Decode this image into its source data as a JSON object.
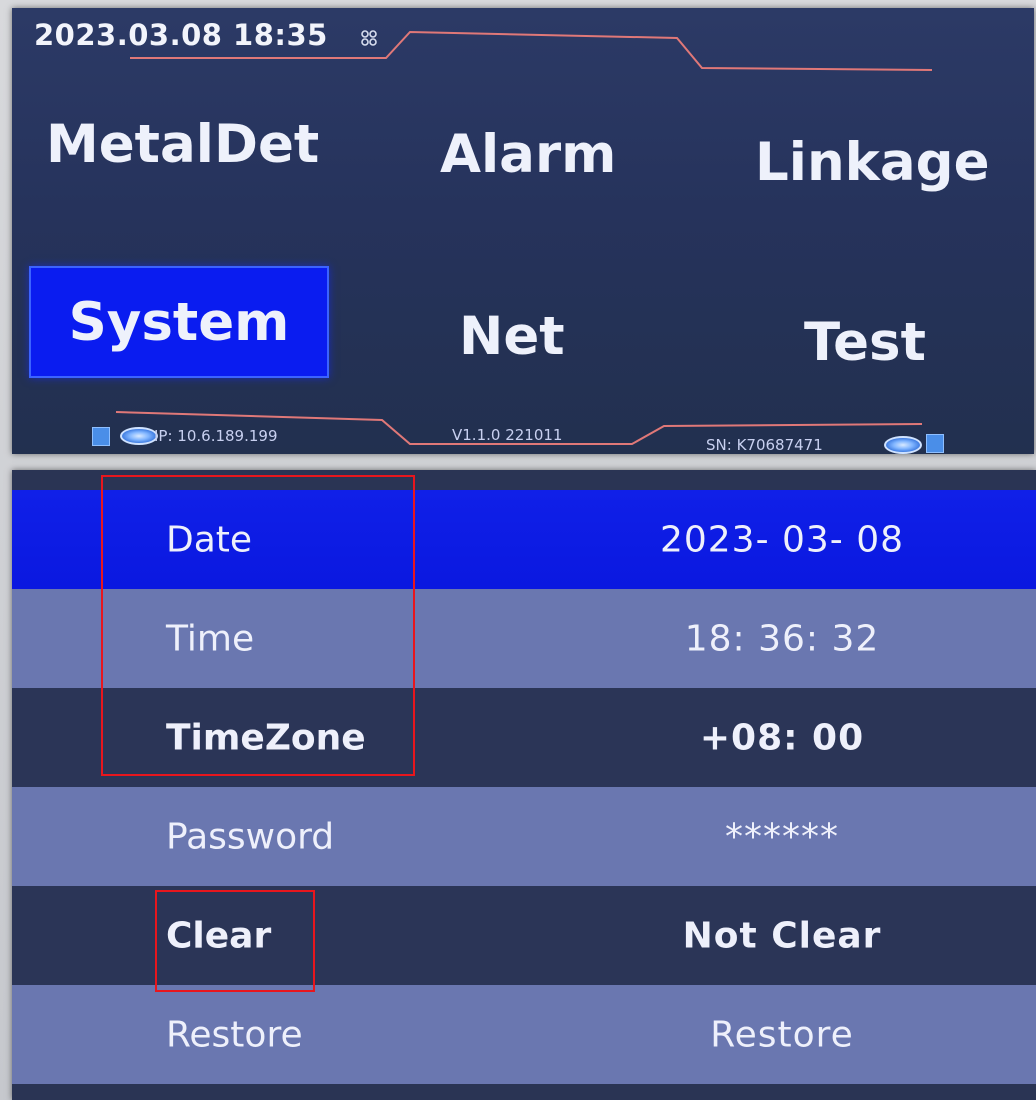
{
  "top_screen": {
    "datetime": "2023.03.08 18:35",
    "menu": [
      {
        "id": "metaldet",
        "label": "MetalDet",
        "active": false
      },
      {
        "id": "alarm",
        "label": "Alarm",
        "active": false
      },
      {
        "id": "linkage",
        "label": "Linkage",
        "active": false
      },
      {
        "id": "system",
        "label": "System",
        "active": true
      },
      {
        "id": "net",
        "label": "Net",
        "active": false
      },
      {
        "id": "test",
        "label": "Test",
        "active": false
      }
    ],
    "footer": {
      "ip": "IP: 10.6.189.199",
      "version": "V1.1.0 221011",
      "sn": "SN: K70687471"
    },
    "icons": [
      "signal-icon",
      "square-icon",
      "eye-icon"
    ]
  },
  "settings": {
    "rows": [
      {
        "label": "Date",
        "value": "2023- 03- 08",
        "selected": true
      },
      {
        "label": "Time",
        "value": "18: 36: 32",
        "selected": false
      },
      {
        "label": "TimeZone",
        "value": "+08: 00",
        "selected": false
      },
      {
        "label": "Password",
        "value": "******",
        "selected": false
      },
      {
        "label": "Clear",
        "value": "Not Clear",
        "selected": false
      },
      {
        "label": "Restore",
        "value": "Restore",
        "selected": false
      }
    ]
  },
  "colors": {
    "screen_bg": "#26335c",
    "selected_blue": "#0a1cf0",
    "row_dark": "#2b3557",
    "row_light": "#6a77b0",
    "highlight_red": "#e8161d",
    "deco_line": "#e07878"
  }
}
